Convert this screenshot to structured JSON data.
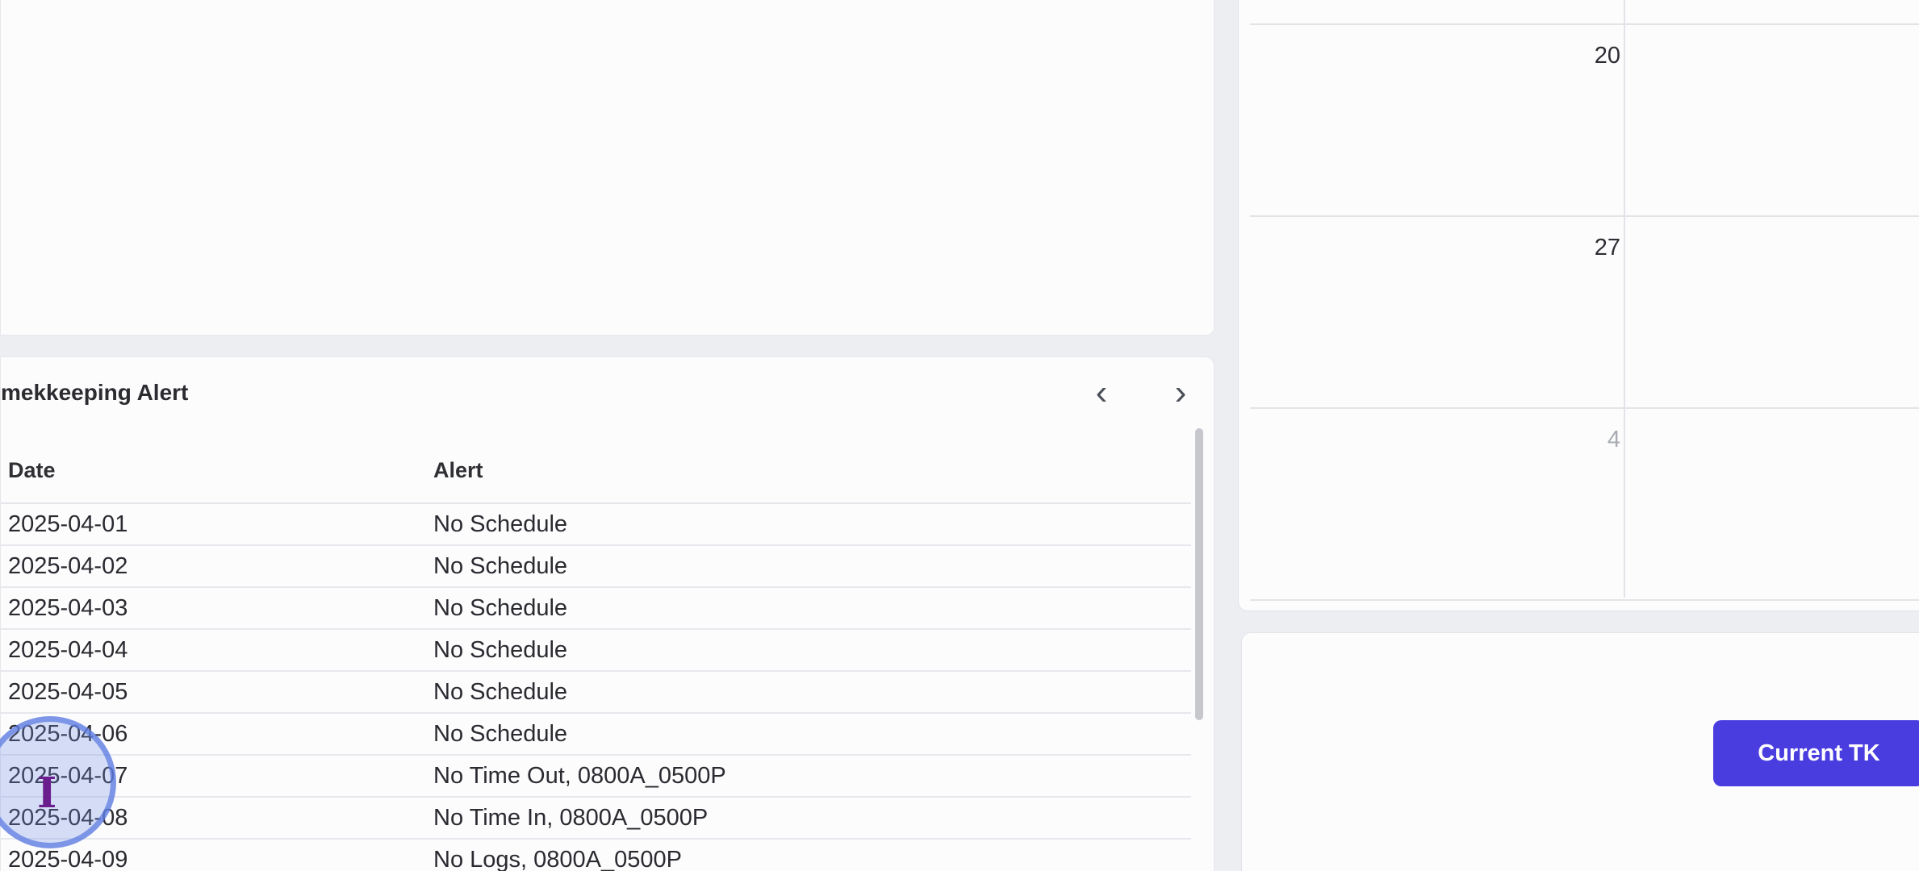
{
  "timekeeping_alert": {
    "title": "mekkeeping Alert",
    "prev_icon": "‹",
    "next_icon": "›",
    "columns": {
      "date": "Date",
      "alert": "Alert"
    },
    "rows": [
      {
        "date": "2025-04-01",
        "alert": "No Schedule"
      },
      {
        "date": "2025-04-02",
        "alert": "No Schedule"
      },
      {
        "date": "2025-04-03",
        "alert": "No Schedule"
      },
      {
        "date": "2025-04-04",
        "alert": "No Schedule"
      },
      {
        "date": "2025-04-05",
        "alert": "No Schedule"
      },
      {
        "date": "2025-04-06",
        "alert": "No Schedule"
      },
      {
        "date": "2025-04-07",
        "alert": "No Time Out, 0800A_0500P"
      },
      {
        "date": "2025-04-08",
        "alert": "No Time In, 0800A_0500P"
      },
      {
        "date": "2025-04-09",
        "alert": "No Logs, 0800A_0500P"
      }
    ]
  },
  "calendar": {
    "days": [
      {
        "label": "20",
        "muted": false
      },
      {
        "label": "27",
        "muted": false
      },
      {
        "label": "4",
        "muted": true
      }
    ]
  },
  "actions": {
    "current_tk_label": "Current TK"
  },
  "cursor": {
    "glyph": "I"
  },
  "colors": {
    "accent": "#4a3de0",
    "panel": "#fcfcfd",
    "background": "#eceef2"
  }
}
